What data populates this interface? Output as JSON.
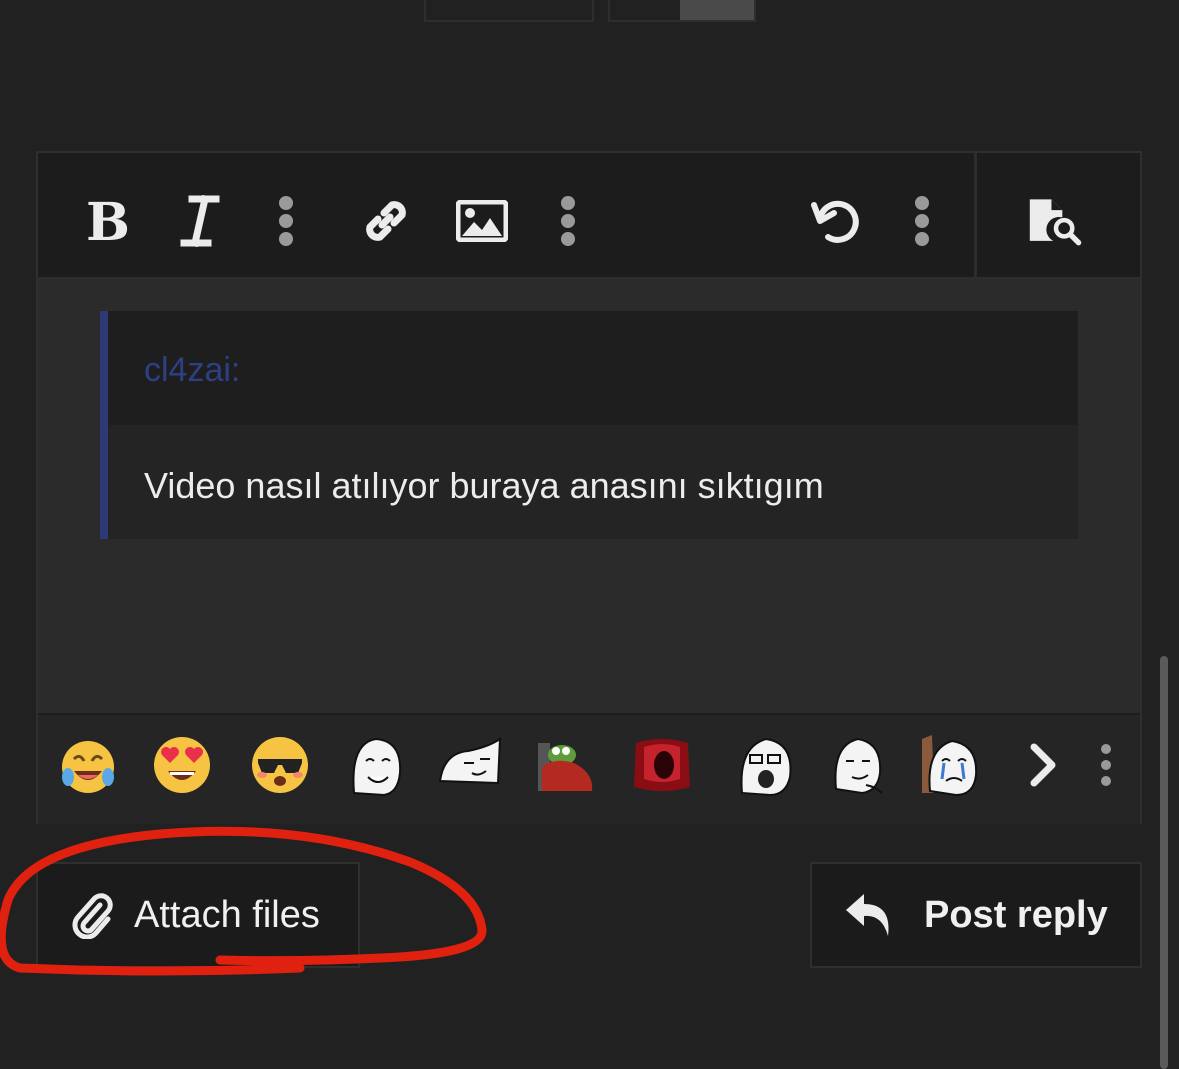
{
  "toolbar": {
    "buttons": [
      {
        "name": "bold-icon"
      },
      {
        "name": "italic-icon"
      },
      {
        "name": "more-text-options-icon"
      },
      {
        "name": "link-icon"
      },
      {
        "name": "image-icon"
      },
      {
        "name": "more-insert-options-icon"
      },
      {
        "name": "undo-icon"
      },
      {
        "name": "more-options-icon"
      },
      {
        "name": "preview-icon"
      }
    ]
  },
  "quote": {
    "author": "cl4zai:",
    "body": "Video nasıl atılıyor buraya anasını sıktıgım"
  },
  "smilies": [
    "laughing-crying-emoji",
    "heart-eyes-emoji",
    "sunglasses-flushed-emoji",
    "wojak-smile-sticker",
    "wojak-smug-sticker",
    "pepe-blanket-sticker",
    "red-gem-sticker",
    "soyjak-sticker",
    "wojak-smirk-sticker",
    "crying-wojak-sticker"
  ],
  "actions": {
    "attach_label": "Attach files",
    "post_label": "Post reply"
  },
  "colors": {
    "background": "#212121",
    "quote_border": "#2e3a75",
    "annotation": "#e0210f"
  }
}
